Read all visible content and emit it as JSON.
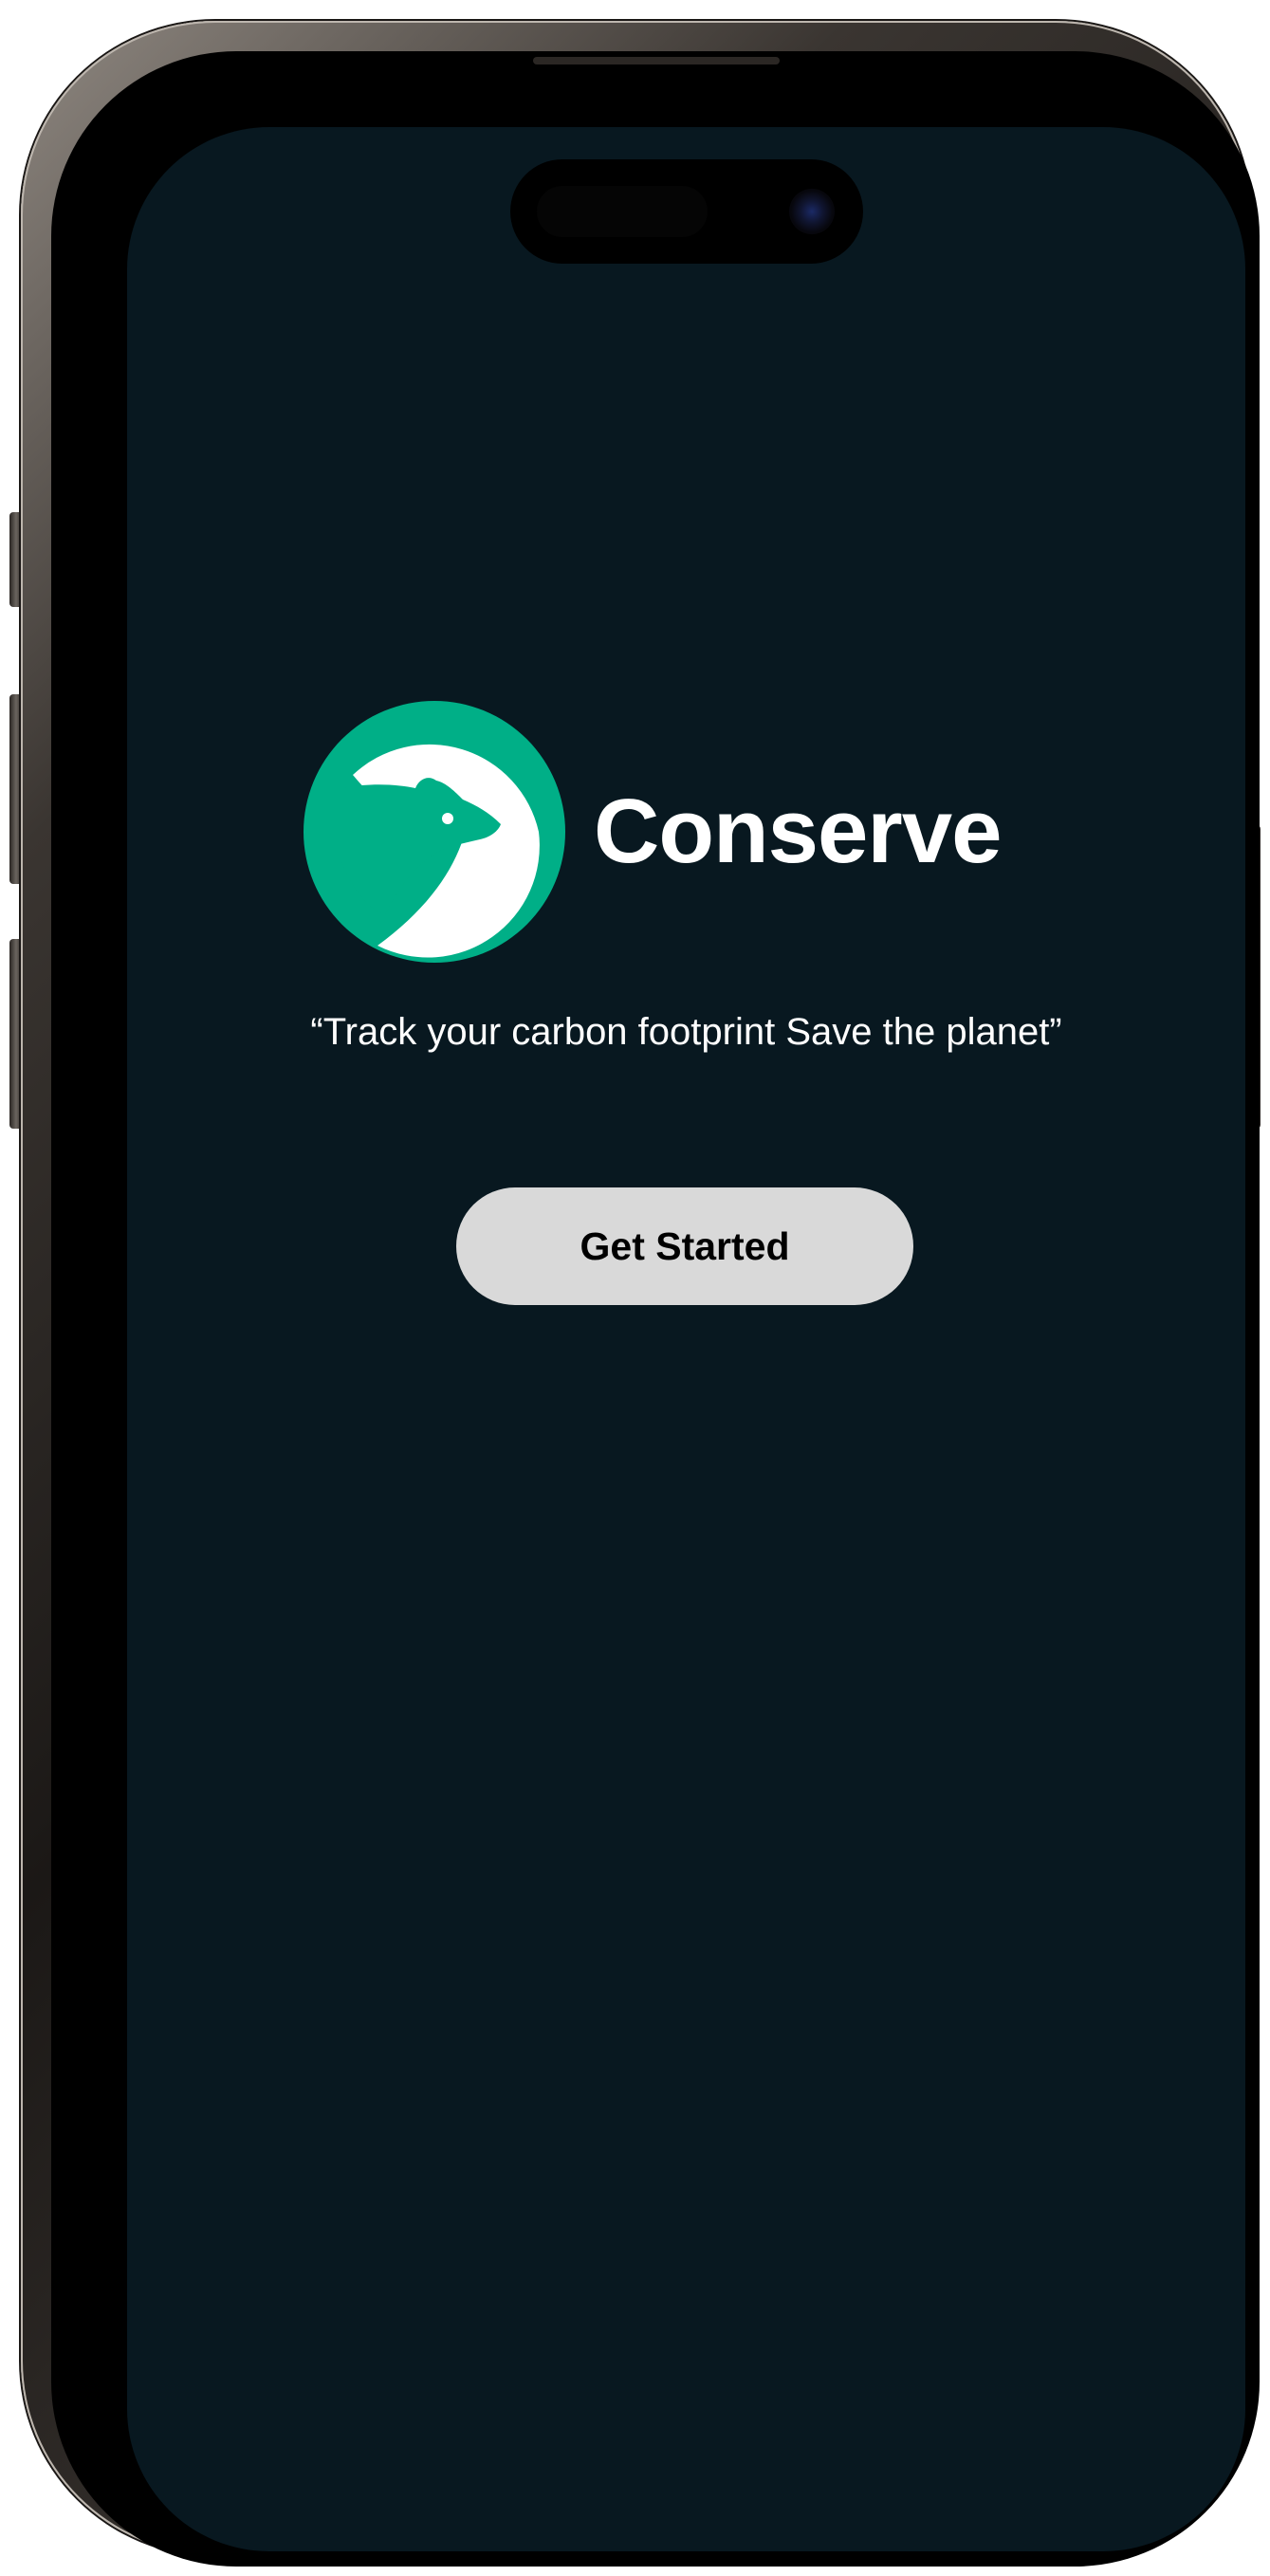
{
  "app": {
    "name": "Conserve",
    "tagline": "“Track your carbon footprint Save the planet”"
  },
  "actions": {
    "get_started_label": "Get Started"
  },
  "colors": {
    "screen_background": "#081820",
    "logo_green": "#00AF87",
    "button_background": "#D9D9D9",
    "text_primary": "#FFFFFF",
    "button_text": "#000000"
  },
  "icons": {
    "logo": "bear-in-circle-logo"
  }
}
